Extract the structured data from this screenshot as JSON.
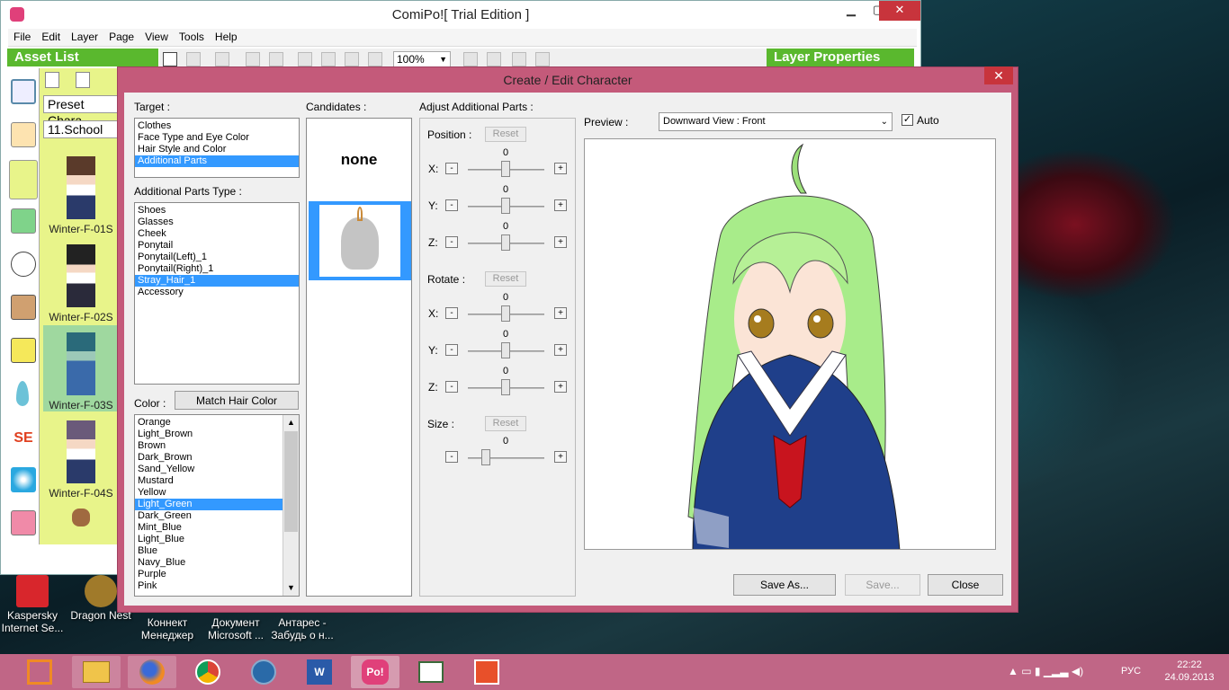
{
  "app": {
    "title": "ComiPo![ Trial Edition ]"
  },
  "menu": [
    "File",
    "Edit",
    "Layer",
    "Page",
    "View",
    "Tools",
    "Help"
  ],
  "toolbar": {
    "zoom": "100%"
  },
  "asset_list": {
    "header": "Asset List",
    "preset": "Preset Chara",
    "category": "11.School",
    "items": [
      "Winter-F-01S",
      "Winter-F-02S",
      "Winter-F-03S",
      "Winter-F-04S"
    ]
  },
  "layer_properties": {
    "header": "Layer Properties"
  },
  "dialog": {
    "title": "Create / Edit Character",
    "close": "✕",
    "target_label": "Target :",
    "targets": [
      "Clothes",
      "Face Type and Eye Color",
      "Hair Style and Color",
      "Additional Parts"
    ],
    "target_selected": "Additional Parts",
    "parts_type_label": "Additional Parts Type :",
    "parts_types": [
      "Shoes",
      "Glasses",
      "Cheek",
      "Ponytail",
      "Ponytail(Left)_1",
      "Ponytail(Right)_1",
      "Stray_Hair_1",
      "Accessory"
    ],
    "parts_selected": "Stray_Hair_1",
    "color_label": "Color :",
    "match_hair": "Match Hair Color",
    "colors": [
      "Orange",
      "Light_Brown",
      "Brown",
      "Dark_Brown",
      "Sand_Yellow",
      "Mustard",
      "Yellow",
      "Light_Green",
      "Dark_Green",
      "Mint_Blue",
      "Light_Blue",
      "Blue",
      "Navy_Blue",
      "Purple",
      "Pink"
    ],
    "color_selected": "Light_Green",
    "candidates_label": "Candidates :",
    "candidate_none": "none",
    "adjust_label": "Adjust Additional Parts :",
    "position_label": "Position :",
    "rotate_label": "Rotate :",
    "size_label": "Size :",
    "reset": "Reset",
    "axes": [
      "X:",
      "Y:",
      "Z:"
    ],
    "minus": "-",
    "plus": "+",
    "position": [
      0,
      0,
      0
    ],
    "rotate": [
      0,
      0,
      0
    ],
    "size": 0,
    "preview_label": "Preview :",
    "view": "Downward View : Front",
    "auto_label": "Auto",
    "save_as": "Save As...",
    "save": "Save...",
    "close_btn": "Close"
  },
  "desktop": [
    {
      "l1": "Kaspersky",
      "l2": "Internet Se..."
    },
    {
      "l1": "Dragon Nest",
      "l2": ""
    },
    {
      "l1": "Коннект",
      "l2": "Менеджер"
    },
    {
      "l1": "Документ",
      "l2": "Microsoft ..."
    },
    {
      "l1": "Антарес -",
      "l2": "Забудь о н..."
    }
  ],
  "tray": {
    "lang": "РУС",
    "time": "22:22",
    "date": "24.09.2013"
  }
}
